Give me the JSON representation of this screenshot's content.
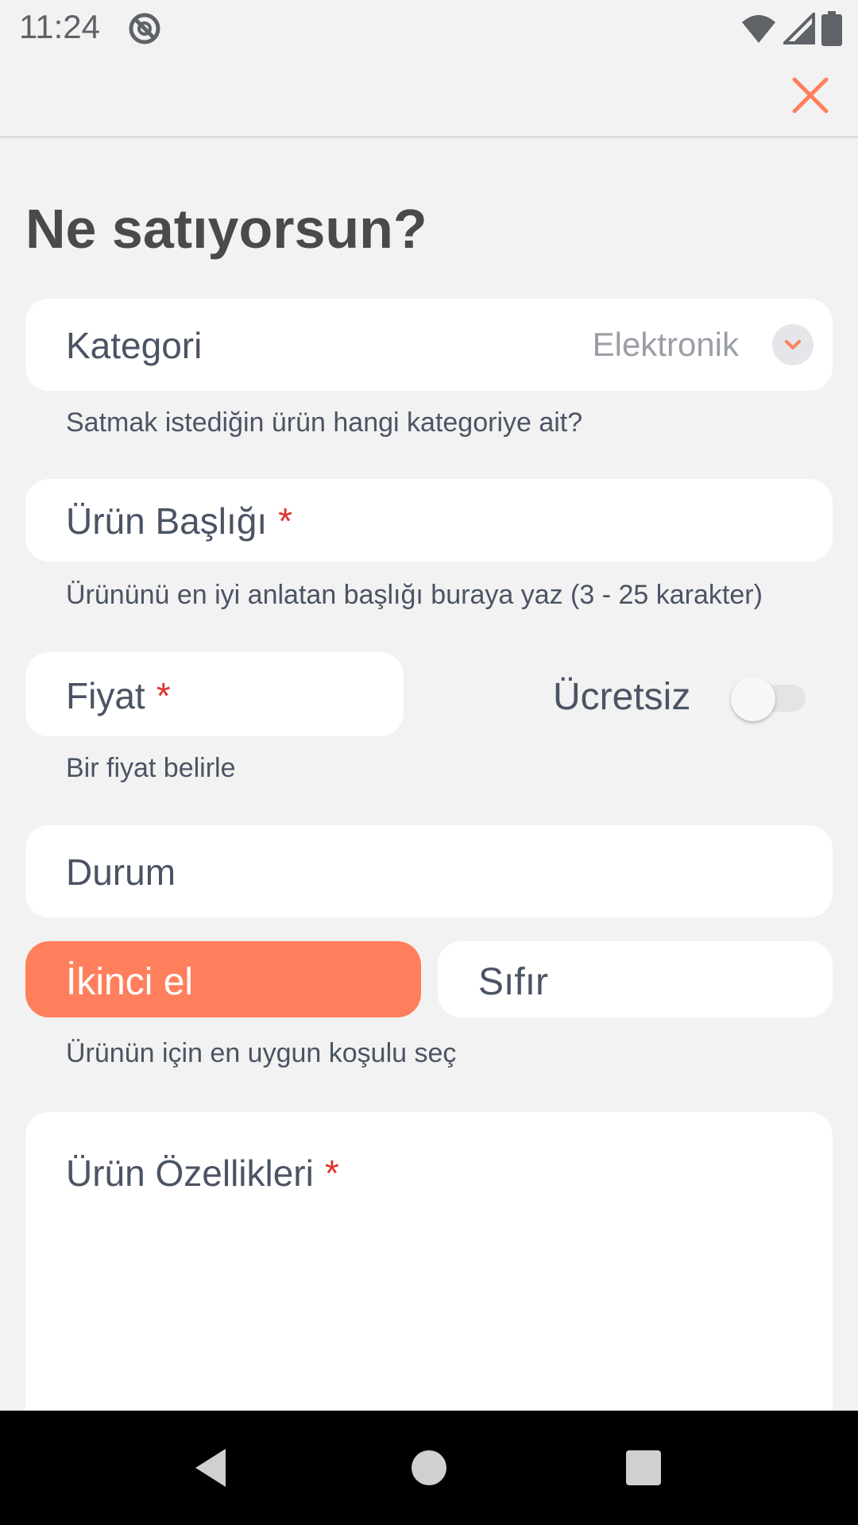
{
  "status_bar": {
    "time": "11:24",
    "icons": [
      "do-not-disturb-icon",
      "wifi-icon",
      "signal-icon",
      "battery-icon"
    ]
  },
  "top_bar": {
    "close_icon": "close-icon"
  },
  "page": {
    "title": "Ne satıyorsun?"
  },
  "form": {
    "category": {
      "label": "Kategori",
      "value": "Elektronik",
      "helper": "Satmak istediğin ürün hangi kategoriye ait?"
    },
    "title": {
      "label": "Ürün Başlığı",
      "required_mark": "*",
      "helper": "Ürününü en iyi anlatan başlığı buraya yaz (3 - 25 karakter)"
    },
    "price": {
      "label": "Fiyat",
      "required_mark": "*",
      "helper": "Bir fiyat belirle",
      "free_label": "Ücretsiz",
      "free_enabled": false
    },
    "condition": {
      "label": "Durum",
      "options": [
        {
          "label": "İkinci el",
          "selected": true
        },
        {
          "label": "Sıfır",
          "selected": false
        }
      ],
      "helper": "Ürünün için en uygun koşulu seç"
    },
    "features": {
      "label": "Ürün Özellikleri",
      "required_mark": "*"
    }
  },
  "nav_bar": {
    "buttons": [
      "back-icon",
      "home-icon",
      "recents-icon"
    ]
  },
  "colors": {
    "accent": "#ff7f5c",
    "background": "#f2f2f2",
    "card": "#ffffff",
    "text": "#4b5464",
    "required": "#e0332e"
  }
}
